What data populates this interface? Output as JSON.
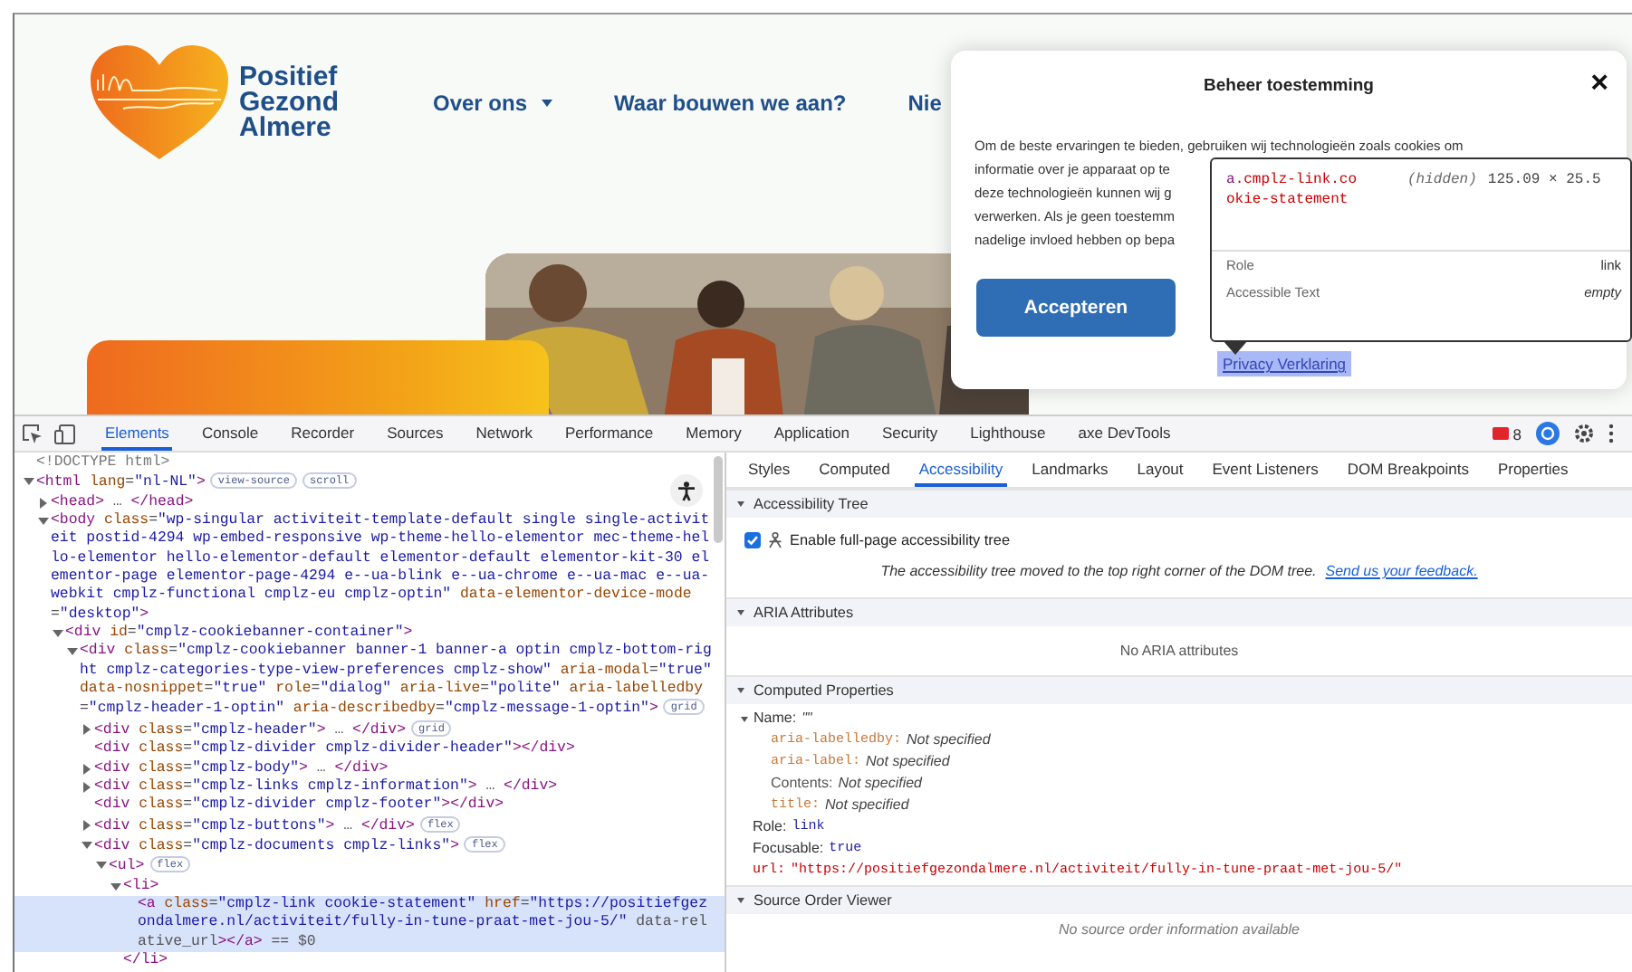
{
  "site": {
    "logo_text": "Positief Gezond Almere",
    "nav": [
      {
        "label": "Over ons",
        "has_menu": true
      },
      {
        "label": "Waar bouwen we aan?",
        "has_menu": false
      },
      {
        "label": "Nie",
        "has_menu": false
      }
    ]
  },
  "cookie_dialog": {
    "title": "Beheer toestemming",
    "close": "×",
    "body_lines": [
      "Om de beste ervaringen te bieden, gebruiken wij technologieën zoals cookies om",
      "informatie over je apparaat op te",
      "deze technologieën kunnen wij g",
      "verwerken. Als je geen toestemm",
      "nadelige invloed hebben op bepa"
    ],
    "accept": "Accepteren",
    "privacy_link": "Privacy Verklaring"
  },
  "inspect_tooltip": {
    "selector_tag": "a",
    "selector_classes": ".cmplz-link.cookie-statement",
    "visibility": "(hidden)",
    "size": "125.09 × 25.5",
    "rows": [
      {
        "label": "Role",
        "value": "link",
        "italic": false
      },
      {
        "label": "Accessible Text",
        "value": "empty",
        "italic": true
      }
    ]
  },
  "devtools": {
    "tabs": [
      {
        "label": "Elements",
        "selected": true
      },
      {
        "label": "Console",
        "selected": false
      },
      {
        "label": "Recorder",
        "selected": false
      },
      {
        "label": "Sources",
        "selected": false
      },
      {
        "label": "Network",
        "selected": false
      },
      {
        "label": "Performance",
        "selected": false
      },
      {
        "label": "Memory",
        "selected": false
      },
      {
        "label": "Application",
        "selected": false
      },
      {
        "label": "Security",
        "selected": false
      },
      {
        "label": "Lighthouse",
        "selected": false
      },
      {
        "label": "axe DevTools",
        "selected": false
      }
    ],
    "error_count": "8",
    "dom_tree": [
      {
        "text": "<!DOCTYPE html>",
        "kind": "comment"
      },
      {
        "text": "<html lang=\"nl-NL\">",
        "expanded": true,
        "badges": [
          "view-source",
          "scroll"
        ],
        "children": [
          {
            "text": "<head> … </head>",
            "expanded": false
          },
          {
            "text": "<body class=\"wp-singular activiteit-template-default single single-activiteit postid-4294 wp-embed-responsive wp-theme-hello-elementor mec-theme-hello-elementor hello-elementor-default elementor-default elementor-kit-30 elementor-page elementor-page-4294 e--ua-blink e--ua-chrome e--ua-mac e--ua-webkit cmplz-functional cmplz-eu cmplz-optin\" data-elementor-device-mode=\"desktop\">",
            "expanded": true,
            "children": [
              {
                "text": "<div id=\"cmplz-cookiebanner-container\">",
                "expanded": true,
                "children": [
                  {
                    "text": "<div class=\"cmplz-cookiebanner banner-1 banner-a optin cmplz-bottom-right cmplz-categories-type-view-preferences cmplz-show\" aria-modal=\"true\" data-nosnippet=\"true\" role=\"dialog\" aria-live=\"polite\" aria-labelledby=\"cmplz-header-1-optin\" aria-describedby=\"cmplz-message-1-optin\">",
                    "expanded": true,
                    "badges": [
                      "grid"
                    ],
                    "children": [
                      {
                        "text": "<div class=\"cmplz-header\"> … </div>",
                        "expanded": false,
                        "badges": [
                          "grid"
                        ]
                      },
                      {
                        "text": "<div class=\"cmplz-divider cmplz-divider-header\"></div>"
                      },
                      {
                        "text": "<div class=\"cmplz-body\"> … </div>",
                        "expanded": false
                      },
                      {
                        "text": "<div class=\"cmplz-links cmplz-information\"> … </div>",
                        "expanded": false
                      },
                      {
                        "text": "<div class=\"cmplz-divider cmplz-footer\"></div>"
                      },
                      {
                        "text": "<div class=\"cmplz-buttons\"> … </div>",
                        "expanded": false,
                        "badges": [
                          "flex"
                        ]
                      },
                      {
                        "text": "<div class=\"cmplz-documents cmplz-links\">",
                        "expanded": true,
                        "badges": [
                          "flex"
                        ],
                        "children": [
                          {
                            "text": "<ul>",
                            "expanded": true,
                            "badges": [
                              "flex"
                            ],
                            "children": [
                              {
                                "text": "<li>",
                                "expanded": true,
                                "closing": "</li>",
                                "children": [
                                  {
                                    "text": "<a class=\"cmplz-link cookie-statement\" href=\"https://positiefgezondalmere.nl/activiteit/fully-in-tune-praat-met-jou-5/\" data-relative_url></a> == $0",
                                    "selected": true
                                  }
                                ]
                              }
                            ]
                          }
                        ]
                      }
                    ]
                  }
                ]
              }
            ]
          }
        ]
      }
    ],
    "sidebar_tabs": [
      {
        "label": "Styles",
        "selected": false
      },
      {
        "label": "Computed",
        "selected": false
      },
      {
        "label": "Accessibility",
        "selected": true
      },
      {
        "label": "Landmarks",
        "selected": false
      },
      {
        "label": "Layout",
        "selected": false
      },
      {
        "label": "Event Listeners",
        "selected": false
      },
      {
        "label": "DOM Breakpoints",
        "selected": false
      },
      {
        "label": "Properties",
        "selected": false
      }
    ],
    "sections": [
      {
        "title": "Accessibility Tree",
        "expanded": true,
        "kind": "setting",
        "checkbox": {
          "label": "Enable full-page accessibility tree",
          "checked": true
        },
        "message": "The accessibility tree moved to the top right corner of the DOM tree.",
        "link": "Send us your feedback."
      },
      {
        "title": "ARIA Attributes",
        "expanded": true,
        "kind": "empty",
        "message": "No ARIA attributes"
      },
      {
        "title": "Computed Properties",
        "expanded": true,
        "kind": "properties",
        "properties": [
          {
            "key": "Name:",
            "value": "\"\"",
            "kind": "plain",
            "expanded": true,
            "children": [
              {
                "key": "aria-labelledby:",
                "value": "Not specified",
                "kind": "attr"
              },
              {
                "key": "aria-label:",
                "value": "Not specified",
                "kind": "attr"
              },
              {
                "key": "Contents:",
                "value": "Not specified",
                "kind": "source"
              },
              {
                "key": "title:",
                "value": "Not specified",
                "kind": "attr"
              }
            ]
          },
          {
            "key": "Role:",
            "value": "link",
            "kind": "plain"
          },
          {
            "key": "Focusable:",
            "value": "true",
            "kind": "plain"
          },
          {
            "key": "url:",
            "value": "\"https://positiefgezondalmere.nl/activiteit/fully-in-tune-praat-met-jou-5/\"",
            "kind": "url"
          }
        ]
      },
      {
        "title": "Source Order Viewer",
        "expanded": true,
        "kind": "empty",
        "message": "No source order information available"
      }
    ]
  }
}
